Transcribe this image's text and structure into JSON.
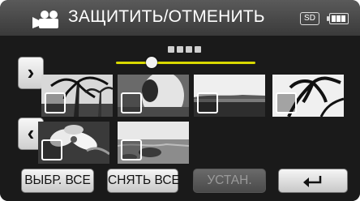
{
  "header": {
    "title": "ЗАЩИТИТЬ/ОТМЕНИТЬ",
    "media_badge": "SD",
    "battery_level": 1.0
  },
  "pager": {
    "current_page_fraction": 0.2
  },
  "navigation": {
    "next_label": "›",
    "prev_label": "‹"
  },
  "thumbnails": [
    {
      "name": "palm-trees",
      "checked": false
    },
    {
      "name": "person-portrait",
      "checked": false
    },
    {
      "name": "beach-horizon",
      "checked": false
    },
    {
      "name": "palm-silhouette",
      "checked": false
    },
    {
      "name": "flowers",
      "checked": false
    },
    {
      "name": "sea-rocks",
      "checked": false
    }
  ],
  "buttons": {
    "select_all": "ВЫБР. ВСЕ",
    "deselect_all": "СНЯТЬ ВСЕ",
    "set": "УСТАН.",
    "set_enabled": false
  },
  "colors": {
    "slider_accent": "#d8d800"
  },
  "icons": {
    "mode": "video-camera-icon",
    "return": "return-arrow-icon"
  }
}
